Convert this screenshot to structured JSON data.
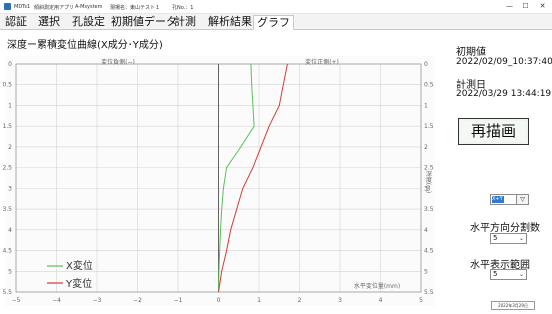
{
  "window": {
    "app_name": "MDTs1",
    "app_subtitle": "傾斜測定用アプリ",
    "company": "A-Msystem",
    "site_label": "現場名：",
    "site_name": "東山テスト１",
    "hole_label": "孔No.：1",
    "min_glyph": "—",
    "max_glyph": "☐",
    "close_glyph": "✕"
  },
  "tabs": [
    "認証",
    "選択",
    "孔設定",
    "初期値データ",
    "計測",
    "解析結果",
    "グラフ"
  ],
  "active_tab": "グラフ",
  "chart_title": "深度ー累積変位曲線(X成分･Y成分)",
  "chart_data": {
    "type": "line",
    "xlabel": "水平変位量(mm)",
    "ylabel_right": "深度(m)",
    "region_left_label": "変位負側(−)",
    "region_right_label": "変位正側(+)",
    "xlim": [
      -5,
      5
    ],
    "ylim": [
      0,
      5.5
    ],
    "y_inverted": true,
    "x_ticks": [
      "−5",
      "−4",
      "−3",
      "−2",
      "−1",
      "0",
      "1",
      "2",
      "3",
      "4",
      "5"
    ],
    "y_ticks": [
      "0",
      "0.5",
      "1",
      "1.5",
      "2",
      "2.5",
      "3",
      "3.5",
      "4",
      "4.5",
      "5",
      "5.5"
    ],
    "grid": true,
    "legend_position": "bottom-left",
    "series": [
      {
        "name": "X変位",
        "color": "#5cbf5c",
        "points": [
          [
            0.8,
            0
          ],
          [
            0.82,
            0.5
          ],
          [
            0.85,
            1.0
          ],
          [
            0.88,
            1.5
          ],
          [
            0.55,
            2.0
          ],
          [
            0.2,
            2.5
          ],
          [
            0.12,
            3.0
          ],
          [
            0.08,
            3.5
          ],
          [
            0.05,
            4.0
          ],
          [
            0.03,
            4.5
          ],
          [
            0.01,
            5.0
          ],
          [
            0.0,
            5.5
          ]
        ]
      },
      {
        "name": "Y変位",
        "color": "#d23b3b",
        "points": [
          [
            1.7,
            0
          ],
          [
            1.6,
            0.5
          ],
          [
            1.5,
            1.0
          ],
          [
            1.25,
            1.5
          ],
          [
            1.05,
            2.0
          ],
          [
            0.85,
            2.5
          ],
          [
            0.6,
            3.0
          ],
          [
            0.45,
            3.5
          ],
          [
            0.3,
            4.0
          ],
          [
            0.2,
            4.5
          ],
          [
            0.08,
            5.0
          ],
          [
            0.0,
            5.5
          ]
        ]
      }
    ]
  },
  "panel": {
    "initial_label": "初期値",
    "initial_value": "2022/02/09_10:37:40",
    "measure_label": "計測日",
    "measure_value": "2022/03/29 13:44:19",
    "redraw_label": "再描画",
    "mini_combo_value": "X+Y",
    "mini_combo_button": "▽",
    "hdiv_label": "水平方向分割数",
    "hdiv_value": "5",
    "hrange_label": "水平表示範囲",
    "hrange_value": "5",
    "combo_arrow": "⌄",
    "stamp": "2022年3月29日"
  }
}
